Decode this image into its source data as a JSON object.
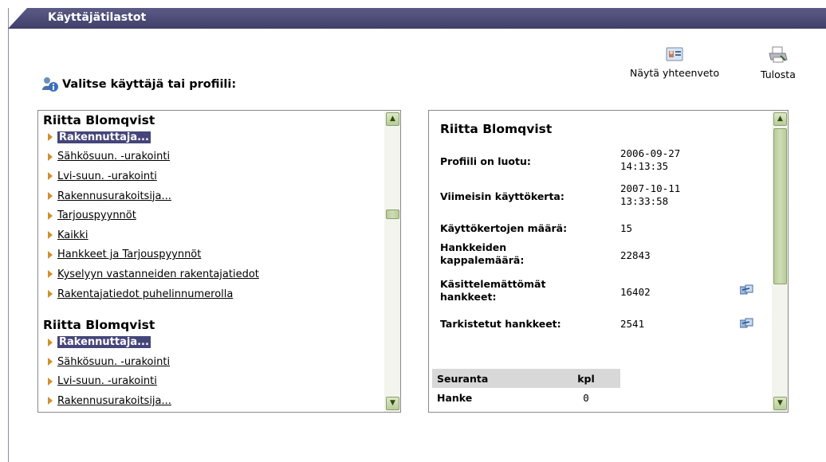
{
  "window": {
    "title": "Käyttäjätilastot"
  },
  "selector": {
    "heading": "Valitse käyttäjä tai profiili:"
  },
  "toolbar": {
    "summary_label": "Näytä yhteenveto",
    "print_label": "Tulosta"
  },
  "left_list": {
    "groups": [
      {
        "name": "Riitta Blomqvist",
        "items": [
          {
            "label": "Rakennuttaja...",
            "selected": true
          },
          {
            "label": "Sähkösuun. -urakointi"
          },
          {
            "label": "Lvi-suun. -urakointi"
          },
          {
            "label": "Rakennusurakoitsija..."
          },
          {
            "label": "Tarjouspyynnöt"
          },
          {
            "label": "Kaikki"
          },
          {
            "label": "Hankkeet ja Tarjouspyynnöt"
          },
          {
            "label": "Kyselyyn vastanneiden rakentajatiedot"
          },
          {
            "label": "Rakentajatiedot puhelinnumerolla"
          }
        ]
      },
      {
        "name": "Riitta Blomqvist",
        "items": [
          {
            "label": "Rakennuttaja...",
            "selected": true
          },
          {
            "label": "Sähkösuun. -urakointi"
          },
          {
            "label": "Lvi-suun. -urakointi"
          },
          {
            "label": "Rakennusurakoitsija..."
          }
        ]
      }
    ]
  },
  "detail": {
    "name": "Riitta Blomqvist",
    "stats": [
      {
        "label": "Profiili on luotu:",
        "value": "2006-09-27\n14:13:35"
      },
      {
        "label": "Viimeisin käyttökerta:",
        "value": "2007-10-11\n13:33:58"
      },
      {
        "label": "Käyttökertojen määrä:",
        "value": "15"
      },
      {
        "label": "Hankkeiden\nkappalemäärä:",
        "value": "22843"
      },
      {
        "label": "Käsittelemättömät\nhankkeet:",
        "value": "16402",
        "icon": "export-icon"
      },
      {
        "label": "Tarkistetut hankkeet:",
        "value": "2541",
        "icon": "export-icon"
      }
    ],
    "tracking": {
      "headers": [
        "Seuranta",
        "kpl"
      ],
      "rows": [
        [
          "Hanke",
          "0"
        ]
      ]
    }
  },
  "colors": {
    "titlebar": "#4a4a76",
    "selected_bg": "#45457a",
    "arrow": "#d0902a",
    "scrollbar": "#b8cc98"
  }
}
